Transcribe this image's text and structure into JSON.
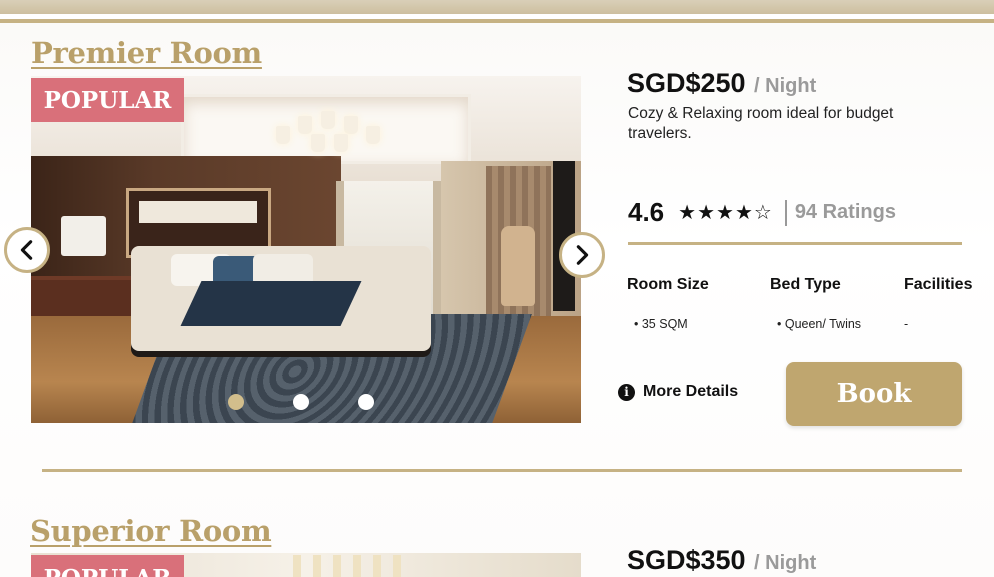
{
  "rooms": [
    {
      "title": "Premier Room",
      "badge": "POPULAR",
      "price": "SGD$250",
      "price_unit": "/ Night",
      "description": "Cozy & Relaxing room ideal for budget travelers.",
      "rating": "4.6",
      "stars": "★★★★☆",
      "stars_value": 4.6,
      "ratings_count": "94 Ratings",
      "specs": [
        {
          "label": "Room Size",
          "value": "• 35 SQM"
        },
        {
          "label": "Bed Type",
          "value": "• Queen/ Twins"
        },
        {
          "label": "Facilities",
          "value": "-"
        }
      ],
      "more_details": "More Details",
      "book_label": "Book",
      "carousel": {
        "slides": 3,
        "active": 1
      }
    },
    {
      "title": "Superior Room",
      "badge": "POPULAR",
      "price": "SGD$350",
      "price_unit": "/ Night"
    }
  ],
  "icons": {
    "prev": "chevron-left-icon",
    "next": "chevron-right-icon",
    "info": "info-icon",
    "star": "star-icon"
  },
  "colors": {
    "accent_gold": "#c6b284",
    "title_gold": "#b9a06a",
    "book_button": "#bfa66f",
    "badge": "#d9707a",
    "muted_text": "#9a9a9a"
  }
}
